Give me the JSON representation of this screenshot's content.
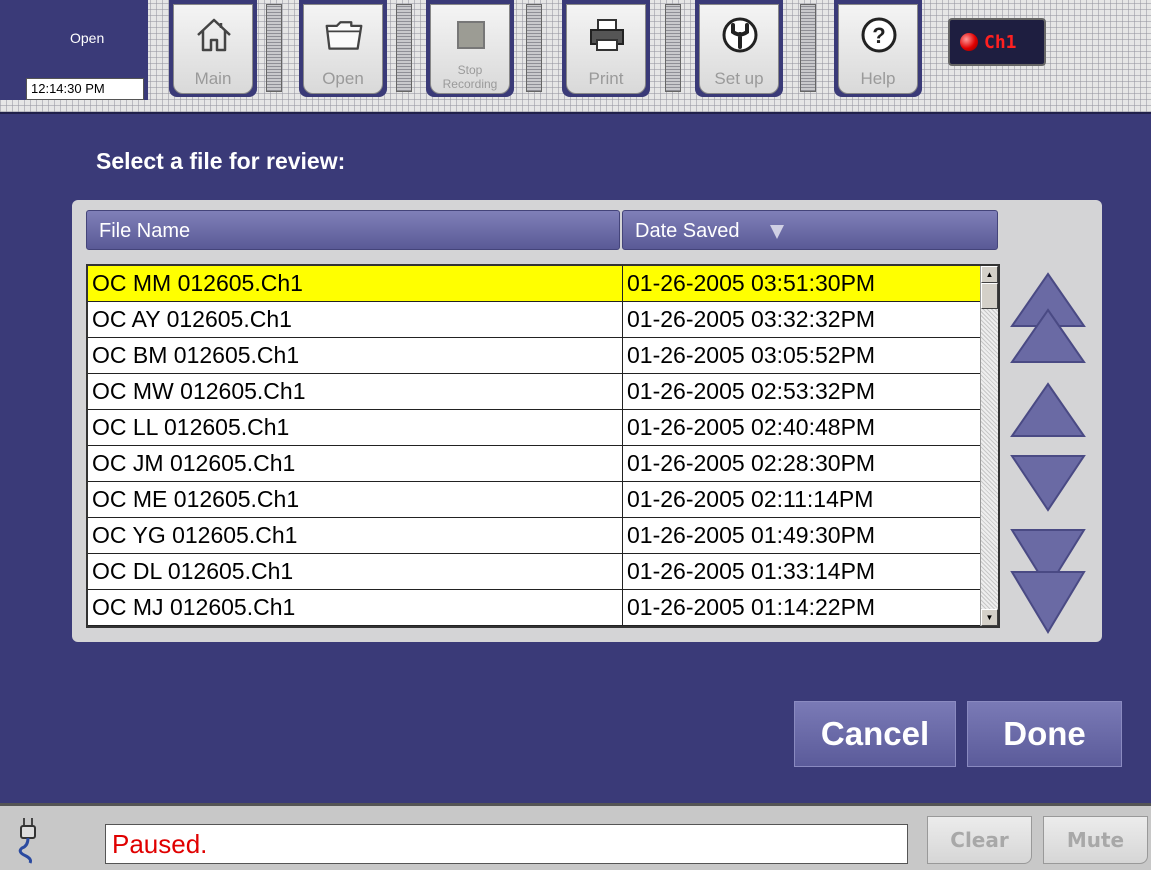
{
  "toolbar": {
    "mode": "Open",
    "time": "12:14:30 PM",
    "buttons": [
      {
        "label": "Main",
        "icon": "home-icon"
      },
      {
        "label": "Open",
        "icon": "folder-icon"
      },
      {
        "label": "Stop Recording",
        "icon": "stop-icon"
      },
      {
        "label": "Print",
        "icon": "printer-icon"
      },
      {
        "label": "Set up",
        "icon": "wrench-icon"
      },
      {
        "label": "Help",
        "icon": "help-icon"
      }
    ],
    "channel": {
      "label": "Ch1",
      "color": "#ff2020"
    }
  },
  "dialog": {
    "heading": "Select a file for review:",
    "columns": {
      "name": "File Name",
      "date": "Date Saved"
    },
    "files": [
      {
        "name": "OC MM 012605.Ch1",
        "date": "01-26-2005 03:51:30PM",
        "selected": true
      },
      {
        "name": "OC AY 012605.Ch1",
        "date": "01-26-2005 03:32:32PM"
      },
      {
        "name": "OC BM 012605.Ch1",
        "date": "01-26-2005 03:05:52PM"
      },
      {
        "name": "OC MW 012605.Ch1",
        "date": "01-26-2005 02:53:32PM"
      },
      {
        "name": "OC LL 012605.Ch1",
        "date": "01-26-2005 02:40:48PM"
      },
      {
        "name": "OC JM 012605.Ch1",
        "date": "01-26-2005 02:28:30PM"
      },
      {
        "name": "OC ME 012605.Ch1",
        "date": "01-26-2005 02:11:14PM"
      },
      {
        "name": "OC YG 012605.Ch1",
        "date": "01-26-2005 01:49:30PM"
      },
      {
        "name": "OC DL 012605.Ch1",
        "date": "01-26-2005 01:33:14PM"
      },
      {
        "name": "OC MJ 012605.Ch1",
        "date": "01-26-2005 01:14:22PM"
      }
    ],
    "cancel_label": "Cancel",
    "done_label": "Done",
    "selection_color": "#ffff00"
  },
  "status": {
    "message": "Paused.",
    "message_color": "#e00000",
    "clear_label": "Clear",
    "mute_label": "Mute"
  }
}
